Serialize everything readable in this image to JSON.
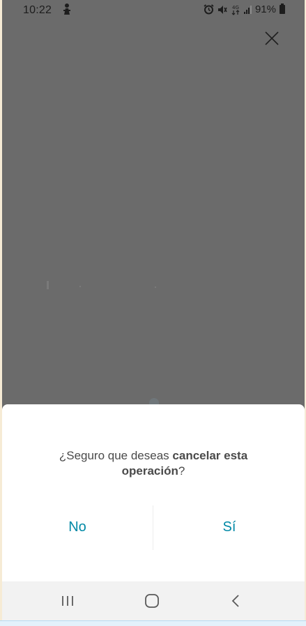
{
  "status_bar": {
    "time": "10:22",
    "network": "4G",
    "battery": "91%",
    "left_icon": "notification-icon",
    "right_icons": [
      "alarm-icon",
      "mute-icon",
      "4g-icon",
      "signal-icon",
      "battery-icon"
    ]
  },
  "header": {
    "close_icon": "close-icon"
  },
  "dialog": {
    "message_prefix": "¿Seguro que deseas ",
    "message_bold": "cancelar esta operación",
    "message_suffix": "?",
    "no_label": "No",
    "yes_label": "Sí"
  },
  "nav_bar": {
    "icons": [
      "recent-apps-icon",
      "home-icon",
      "back-icon"
    ]
  },
  "colors": {
    "overlay": "#6b6b6b",
    "accent": "#0089a6",
    "dialog_bg": "#ffffff",
    "navbar_bg": "#f2f2f2"
  }
}
